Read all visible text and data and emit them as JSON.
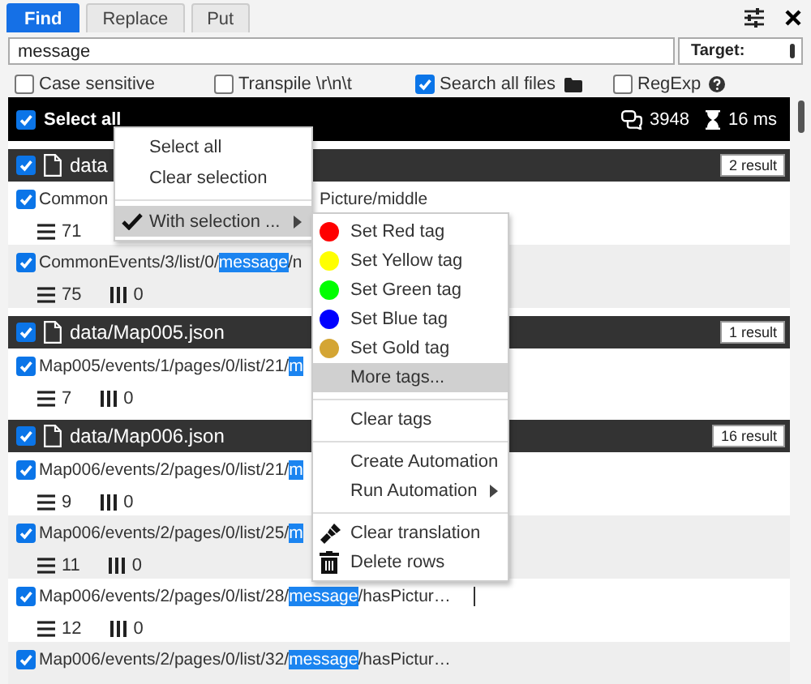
{
  "tabs": [
    {
      "label": "Find",
      "selected": true
    },
    {
      "label": "Replace",
      "selected": false
    },
    {
      "label": "Put",
      "selected": false
    }
  ],
  "search": {
    "value": "message"
  },
  "target": {
    "label": "Target:"
  },
  "options": [
    {
      "kind": "plain",
      "label": "Case sensitive",
      "checked": false
    },
    {
      "kind": "plain",
      "label": "Transpile \\r\\n\\t",
      "checked": false
    },
    {
      "kind": "folder",
      "label": "Search all files",
      "checked": true
    },
    {
      "kind": "help",
      "label": "RegExp",
      "checked": false
    }
  ],
  "results": {
    "select_all": {
      "label": "Select all",
      "checked": true
    },
    "count": "3948",
    "time": "16 ms"
  },
  "groups": [
    {
      "file": "data",
      "checked": true,
      "badge": "2 result",
      "rows": [
        {
          "checked": true,
          "path": "Common",
          "tail": "Picture/middle",
          "lines": "71"
        },
        {
          "checked": true,
          "path": "CommonEvents/3/list/0/",
          "match": "message",
          "after": "/n",
          "lines": "75",
          "cols": "0"
        }
      ]
    },
    {
      "file": "data/Map005.json",
      "checked": true,
      "badge": "1 result",
      "rows": [
        {
          "checked": true,
          "path": "Map005/events/1/pages/0/list/21/",
          "match": "m",
          "lines": "7",
          "cols": "0"
        }
      ]
    },
    {
      "file": "data/Map006.json",
      "checked": true,
      "badge": "16 result",
      "rows": [
        {
          "checked": true,
          "path": "Map006/events/2/pages/0/list/21/",
          "match": "m",
          "lines": "9",
          "cols": "0"
        },
        {
          "checked": true,
          "path": "Map006/events/2/pages/0/list/25/",
          "match": "m",
          "lines": "11",
          "cols": "0"
        },
        {
          "checked": true,
          "path": "Map006/events/2/pages/0/list/28/",
          "match": "message",
          "after": "/hasPictur…",
          "lines": "12",
          "cols": "0"
        },
        {
          "checked": true,
          "path": "Map006/events/2/pages/0/list/32/",
          "match": "message",
          "after": "/hasPictur…"
        }
      ]
    }
  ],
  "context_menu": {
    "items": [
      {
        "kind": "item",
        "label": "Select all",
        "checked": false,
        "selected": false
      },
      {
        "kind": "item",
        "label": "Clear selection",
        "checked": false,
        "selected": false
      },
      {
        "kind": "separator"
      },
      {
        "kind": "submenu",
        "label": "With selection ...",
        "checked": true,
        "selected": true,
        "expanded": true,
        "children": [
          {
            "kind": "tag",
            "label": "Set Red tag",
            "color": "#ff0000",
            "selected": false
          },
          {
            "kind": "tag",
            "label": "Set Yellow tag",
            "color": "#ffff00",
            "selected": false
          },
          {
            "kind": "tag",
            "label": "Set Green tag",
            "color": "#00ff00",
            "selected": false
          },
          {
            "kind": "tag",
            "label": "Set Blue tag",
            "color": "#0000ff",
            "selected": false
          },
          {
            "kind": "tag",
            "label": "Set Gold tag",
            "color": "#d4a534",
            "selected": false
          },
          {
            "kind": "item",
            "label": "More tags...",
            "selected": true
          },
          {
            "kind": "separator"
          },
          {
            "kind": "item",
            "label": "Clear tags",
            "selected": false
          },
          {
            "kind": "separator"
          },
          {
            "kind": "item",
            "label": "Create Automation",
            "selected": false
          },
          {
            "kind": "submenu",
            "label": "Run Automation",
            "selected": false
          },
          {
            "kind": "separator"
          },
          {
            "kind": "clear",
            "label": "Clear translation",
            "selected": false
          },
          {
            "kind": "delete",
            "label": "Delete rows",
            "selected": false
          }
        ]
      }
    ]
  }
}
